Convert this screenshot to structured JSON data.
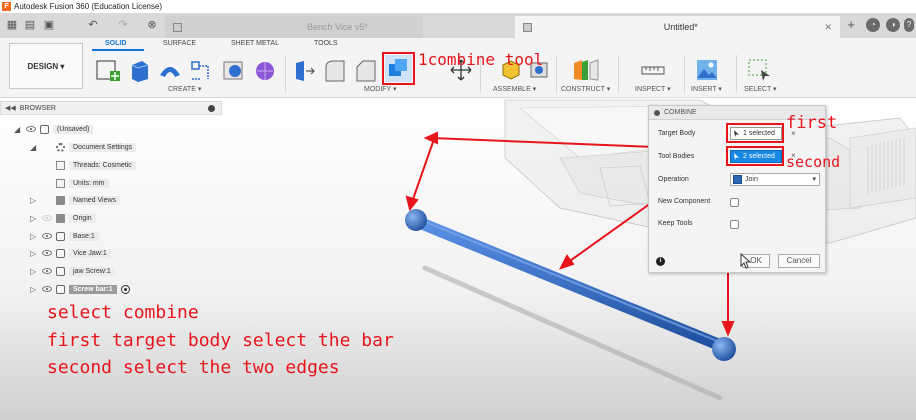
{
  "window": {
    "title": "Autodesk Fusion 360 (Education License)"
  },
  "tabs": [
    {
      "label": "Bench Vice v5*",
      "active": false
    },
    {
      "label": "Untitled*",
      "active": true
    }
  ],
  "ribbon": {
    "workspace_label": "DESIGN ▾",
    "tabs": [
      "SOLID",
      "SURFACE",
      "SHEET METAL",
      "TOOLS"
    ],
    "active_tab": "SOLID",
    "groups": [
      "CREATE ▾",
      "MODIFY ▾",
      "ASSEMBLE ▾",
      "CONSTRUCT ▾",
      "INSPECT ▾",
      "INSERT ▾",
      "SELECT ▾"
    ]
  },
  "browser": {
    "title": "BROWSER",
    "items": [
      {
        "label": "(Unsaved)"
      },
      {
        "label": "Document Settings"
      },
      {
        "label": "Threads: Cosmetic"
      },
      {
        "label": "Units: mm"
      },
      {
        "label": "Named Views"
      },
      {
        "label": "Origin"
      },
      {
        "label": "Base:1"
      },
      {
        "label": "Vice Jaw:1"
      },
      {
        "label": "jaw Screw:1"
      },
      {
        "label": "Screw bar:1",
        "selected": true
      }
    ]
  },
  "combine_dialog": {
    "title": "COMBINE",
    "target_body_label": "Target Body",
    "target_body_value": "1 selected",
    "tool_bodies_label": "Tool Bodies",
    "tool_bodies_value": "2 selected",
    "operation_label": "Operation",
    "operation_value": "Join",
    "new_component_label": "New Component",
    "keep_tools_label": "Keep Tools",
    "ok_label": "OK",
    "cancel_label": "Cancel",
    "clear_icon": "×"
  },
  "annotations": {
    "tool": "1combine tool",
    "first": "first",
    "second": "second",
    "line1": "select combine",
    "line2": "first target body select the bar",
    "line3": "second select the two edges",
    "color": "#e8141c"
  },
  "colors": {
    "accent": "#1476d6",
    "selected_blue": "#1788e4",
    "bar_blue": "#2f6fcf"
  }
}
